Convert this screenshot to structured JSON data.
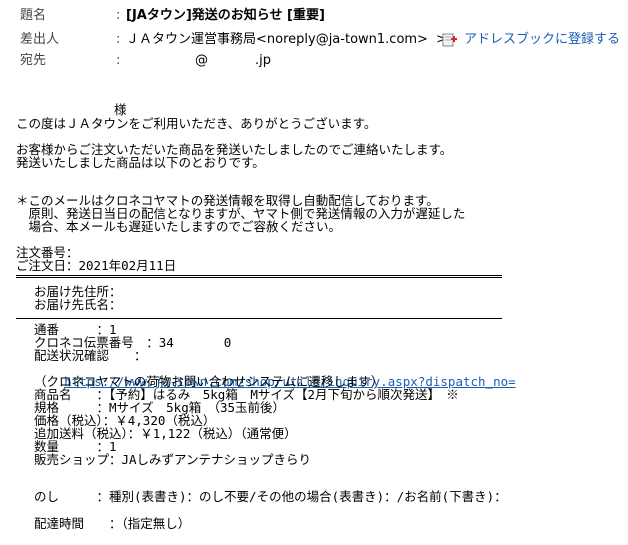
{
  "header": {
    "subject_label": "題名",
    "sender_label": "差出人",
    "to_label": "宛先",
    "colon": ":",
    "subject": "[JAタウン]発送のお知らせ [重要]",
    "sender": "ＪＡタウン運営事務局<noreply@ja-town1.com>",
    "chevron": ">",
    "address_book_link": "アドレスブックに登録する",
    "to_at": "@",
    "to_domain": ".jp"
  },
  "body": {
    "sama": "様",
    "l1": "この度はＪＡタウンをご利用いただき、ありがとうございます。",
    "l2": "お客様からご注文いただいた商品を発送いたしましたのでご連絡いたします。",
    "l3": "発送いたしました商品は以下のとおりです。",
    "l4": "＊このメールはクロネコヤマトの発送情報を取得し自動配信しております。",
    "l5": "　原則、発送日当日の配信となりますが、ヤマト側で発送情報の入力が遅延した",
    "l6": "　場合、本メールも遅延いたしますのでご容赦ください。",
    "order_no": "注文番号：",
    "order_date": "ご注文日：2021年02月11日",
    "delivery_addr": "お届け先住所：",
    "delivery_name": "お届け先氏名：",
    "item_no": "通番　　　：1",
    "tracking": "クロネコ伝票番号　：34　　　　0",
    "status": "配送状況確認　　：",
    "url": "https://www.ja-town.com/shop/utils/inquiry.aspx?dispatch_no=",
    "url_note": "（クロネコヤマトの荷物お問い合わせシステムに遷移します）",
    "product": "商品名　　：【予約】はるみ　5kg箱　Mサイズ【2月下旬から順次発送】　※",
    "spec": "規格　　　：Mサイズ　5kg箱　（35玉前後）",
    "price": "価格（税込）：￥4,320（税込）",
    "extra": "追加送料（税込）：￥1,122（税込）（通常便）",
    "qty": "数量　　　：1",
    "shop": "販売ショップ：JAしみずアンテナショップきらり",
    "noshi": "のし　　　：種別(表書き)：のし不要/その他の場合(表書き)：/お名前(下書き)：",
    "delivery_time": "配達時間　　：（指定無し）"
  }
}
